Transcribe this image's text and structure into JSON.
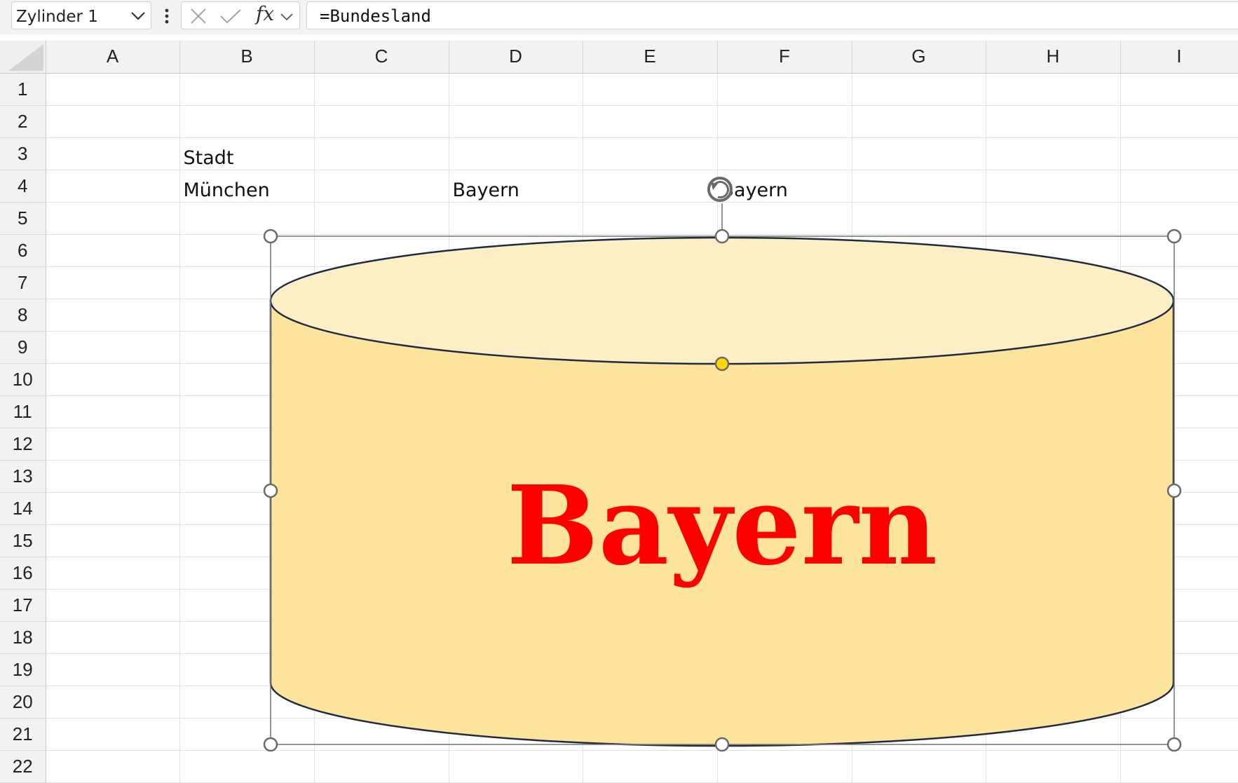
{
  "formula_bar": {
    "name_box": "Zylinder 1",
    "fx_label": "fx",
    "formula": "=Bundesland"
  },
  "columns": [
    "A",
    "B",
    "C",
    "D",
    "E",
    "F",
    "G",
    "H",
    "I"
  ],
  "rows": [
    "1",
    "2",
    "3",
    "4",
    "5",
    "6",
    "7",
    "8",
    "9",
    "10",
    "11",
    "12",
    "13",
    "14",
    "15",
    "16",
    "17",
    "18",
    "19",
    "20",
    "21",
    "22"
  ],
  "cells": {
    "B3": "Stadt",
    "B4": "München",
    "D4": "Bayern",
    "F4": "Bayern"
  },
  "shape": {
    "name": "Zylinder 1",
    "text": "Bayern",
    "fill_top": "#fcefc6",
    "fill_body": "#fde49c",
    "outline": "#1f2a44",
    "text_color": "#ff0000",
    "adjust_handle_color": "#ffd700"
  },
  "icons": [
    "chevron-down-icon",
    "more-options-icon",
    "cancel-icon",
    "enter-icon",
    "fx-icon",
    "rotate-icon"
  ]
}
